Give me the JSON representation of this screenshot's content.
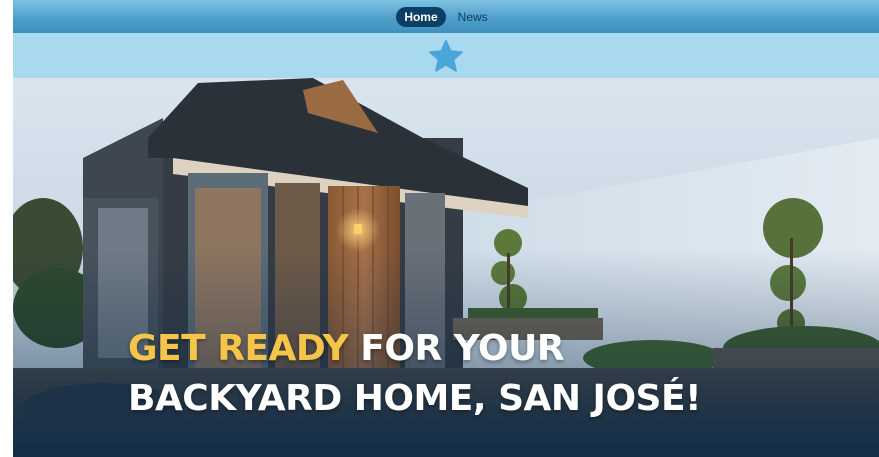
{
  "nav": {
    "items": [
      {
        "label": "Home",
        "active": true
      },
      {
        "label": "News",
        "active": false
      }
    ]
  },
  "band": {
    "icon": "star-icon",
    "icon_color": "#4aa6d8"
  },
  "hero": {
    "headline_accent": "GET READY",
    "headline_rest_line1": " FOR YOUR",
    "headline_line2": "BACKYARD HOME, SAN JOSÉ!",
    "accent_color": "#f5c54a",
    "image": "modern-backyard-home-photo"
  },
  "colors": {
    "nav_bar": "#4f9fca",
    "nav_active_bg": "#0b3f66",
    "band_bg": "#a9d9ef"
  }
}
